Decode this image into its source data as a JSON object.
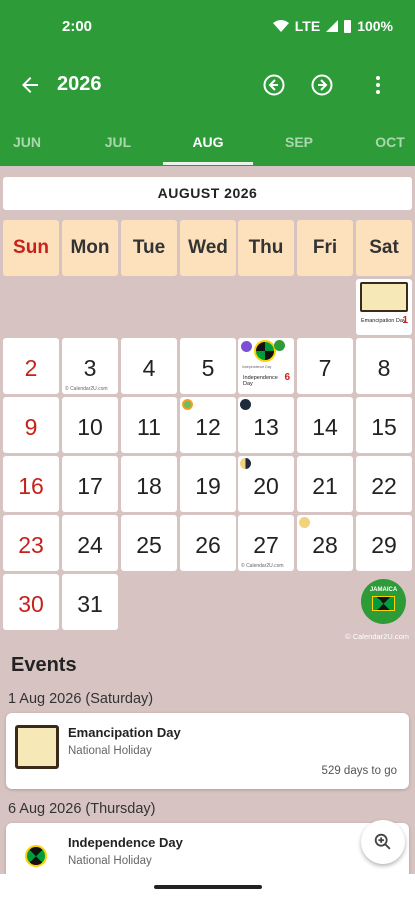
{
  "status": {
    "time": "2:00",
    "network": "LTE",
    "battery": "100%"
  },
  "appbar": {
    "year": "2026"
  },
  "tabs": [
    "JUN",
    "JUL",
    "AUG",
    "SEP",
    "OCT"
  ],
  "calendar": {
    "title": "AUGUST 2026",
    "weekdays": [
      "Sun",
      "Mon",
      "Tue",
      "Wed",
      "Thu",
      "Fri",
      "Sat"
    ],
    "days": [
      "2",
      "3",
      "4",
      "5",
      "6",
      "7",
      "8",
      "9",
      "10",
      "11",
      "12",
      "13",
      "14",
      "15",
      "16",
      "17",
      "18",
      "19",
      "20",
      "21",
      "22",
      "23",
      "24",
      "25",
      "26",
      "27",
      "28",
      "29",
      "30",
      "31"
    ],
    "cell_notes": {
      "sat1_label": "Emancipation Day",
      "sat1_num": "1",
      "aug6_label": "Independence Day",
      "aug6_num": "6",
      "credit_small": "© Calendar2U.com"
    },
    "badge_text": "JAMAICA",
    "copyright": "© Calendar2U.com"
  },
  "events": {
    "title": "Events",
    "groups": [
      {
        "date": "1 Aug 2026 (Saturday)",
        "name": "Emancipation Day",
        "type": "National Holiday",
        "countdown": "529 days to go"
      },
      {
        "date": "6 Aug 2026 (Thursday)",
        "name": "Independence Day",
        "type": "National Holiday",
        "countdown": ""
      }
    ]
  },
  "colors": {
    "green": "#2e9b39",
    "sunday_red": "#c6221b",
    "header_peach": "#fde1bd",
    "background": "#d7c4c2"
  }
}
